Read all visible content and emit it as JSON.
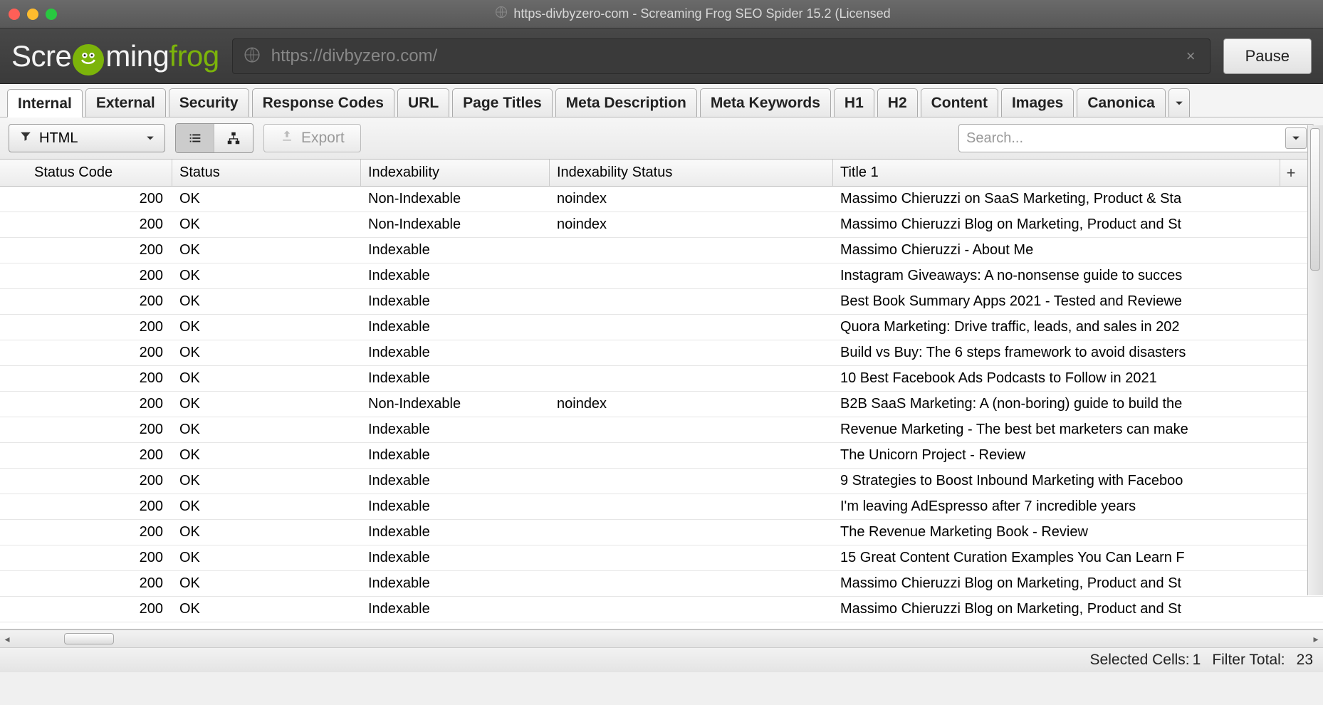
{
  "window": {
    "title": "https-divbyzero-com - Screaming Frog SEO Spider 15.2 (Licensed"
  },
  "logo": {
    "part1": "Scre",
    "part2": "ming",
    "frog": "frog"
  },
  "url_bar": {
    "value": "https://divbyzero.com/"
  },
  "pause_label": "Pause",
  "tabs": [
    "Internal",
    "External",
    "Security",
    "Response Codes",
    "URL",
    "Page Titles",
    "Meta Description",
    "Meta Keywords",
    "H1",
    "H2",
    "Content",
    "Images",
    "Canonica"
  ],
  "active_tab": 0,
  "filter": {
    "label": "HTML"
  },
  "export_label": "Export",
  "search_placeholder": "Search...",
  "columns": [
    "Status Code",
    "Status",
    "Indexability",
    "Indexability Status",
    "Title 1"
  ],
  "rows": [
    {
      "code": "200",
      "status": "OK",
      "idx": "Non-Indexable",
      "idxs": "noindex",
      "title": "Massimo Chieruzzi on SaaS Marketing, Product & Sta"
    },
    {
      "code": "200",
      "status": "OK",
      "idx": "Non-Indexable",
      "idxs": "noindex",
      "title": "Massimo Chieruzzi Blog on Marketing, Product and St"
    },
    {
      "code": "200",
      "status": "OK",
      "idx": "Indexable",
      "idxs": "",
      "title": "Massimo Chieruzzi - About Me"
    },
    {
      "code": "200",
      "status": "OK",
      "idx": "Indexable",
      "idxs": "",
      "title": "Instagram Giveaways: A no-nonsense guide to succes"
    },
    {
      "code": "200",
      "status": "OK",
      "idx": "Indexable",
      "idxs": "",
      "title": "Best Book Summary Apps 2021 - Tested and Reviewe"
    },
    {
      "code": "200",
      "status": "OK",
      "idx": "Indexable",
      "idxs": "",
      "title": "Quora Marketing: Drive traffic, leads, and sales in 202"
    },
    {
      "code": "200",
      "status": "OK",
      "idx": "Indexable",
      "idxs": "",
      "title": "Build vs Buy: The 6 steps framework to avoid disasters"
    },
    {
      "code": "200",
      "status": "OK",
      "idx": "Indexable",
      "idxs": "",
      "title": "10 Best Facebook Ads Podcasts to Follow in 2021"
    },
    {
      "code": "200",
      "status": "OK",
      "idx": "Non-Indexable",
      "idxs": "noindex",
      "title": "B2B SaaS Marketing: A (non-boring) guide to build the"
    },
    {
      "code": "200",
      "status": "OK",
      "idx": "Indexable",
      "idxs": "",
      "title": "Revenue Marketing - The best bet marketers can make"
    },
    {
      "code": "200",
      "status": "OK",
      "idx": "Indexable",
      "idxs": "",
      "title": "The Unicorn Project - Review"
    },
    {
      "code": "200",
      "status": "OK",
      "idx": "Indexable",
      "idxs": "",
      "title": "9 Strategies to Boost Inbound Marketing with Faceboo"
    },
    {
      "code": "200",
      "status": "OK",
      "idx": "Indexable",
      "idxs": "",
      "title": "I'm leaving AdEspresso after 7 incredible years"
    },
    {
      "code": "200",
      "status": "OK",
      "idx": "Indexable",
      "idxs": "",
      "title": "The Revenue Marketing Book - Review"
    },
    {
      "code": "200",
      "status": "OK",
      "idx": "Indexable",
      "idxs": "",
      "title": "15 Great Content Curation Examples You Can Learn F"
    },
    {
      "code": "200",
      "status": "OK",
      "idx": "Indexable",
      "idxs": "",
      "title": "Massimo Chieruzzi Blog on Marketing, Product and St"
    },
    {
      "code": "200",
      "status": "OK",
      "idx": "Indexable",
      "idxs": "",
      "title": "Massimo Chieruzzi Blog on Marketing, Product and St"
    }
  ],
  "status_bar": {
    "selected_label": "Selected Cells:",
    "selected_value": "1",
    "filter_label": "Filter Total:",
    "filter_value": "23"
  }
}
